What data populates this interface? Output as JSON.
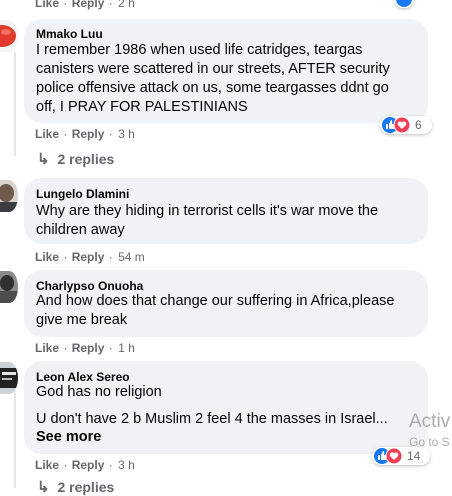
{
  "top_actions": {
    "like": "Like",
    "reply": "Reply",
    "time": "2 h"
  },
  "comments": [
    {
      "name": "Mmako Luu",
      "lines": [
        "I remember 1986 when used life catridges, teargas",
        "canisters were scattered in our streets, AFTER security",
        "police offensive attack on us, some teargasses ddnt go",
        "off, I PRAY FOR PALESTINIANS"
      ],
      "like": "Like",
      "reply": "Reply",
      "time": "3 h",
      "reaction_count": "6",
      "replies": "2 replies"
    },
    {
      "name": "Lungelo Dlamini",
      "lines": [
        "Why are they hiding in terrorist cells it's war move the",
        "children away"
      ],
      "like": "Like",
      "reply": "Reply",
      "time": "54 m"
    },
    {
      "name": "Charlypso Onuoha",
      "lines": [
        "And how does that change our suffering in Africa,please",
        "give me break"
      ],
      "like": "Like",
      "reply": "Reply",
      "time": "1 h"
    },
    {
      "name": "Leon Alex Sereo",
      "lines": [
        "God has no religion",
        "U don't have 2 b Muslim 2 feel 4 the masses in Israel..."
      ],
      "see_more": "See more",
      "like": "Like",
      "reply": "Reply",
      "time": "3 h",
      "reaction_count": "14",
      "replies": "2 replies"
    }
  ],
  "separator": "·",
  "watermark": {
    "line1": "Activ",
    "line2": "Go to S"
  },
  "colors": {
    "bubble": "#f0f2f5",
    "like_blue": "#1877f2",
    "love_red": "#f33e58",
    "muted": "#65676b"
  }
}
